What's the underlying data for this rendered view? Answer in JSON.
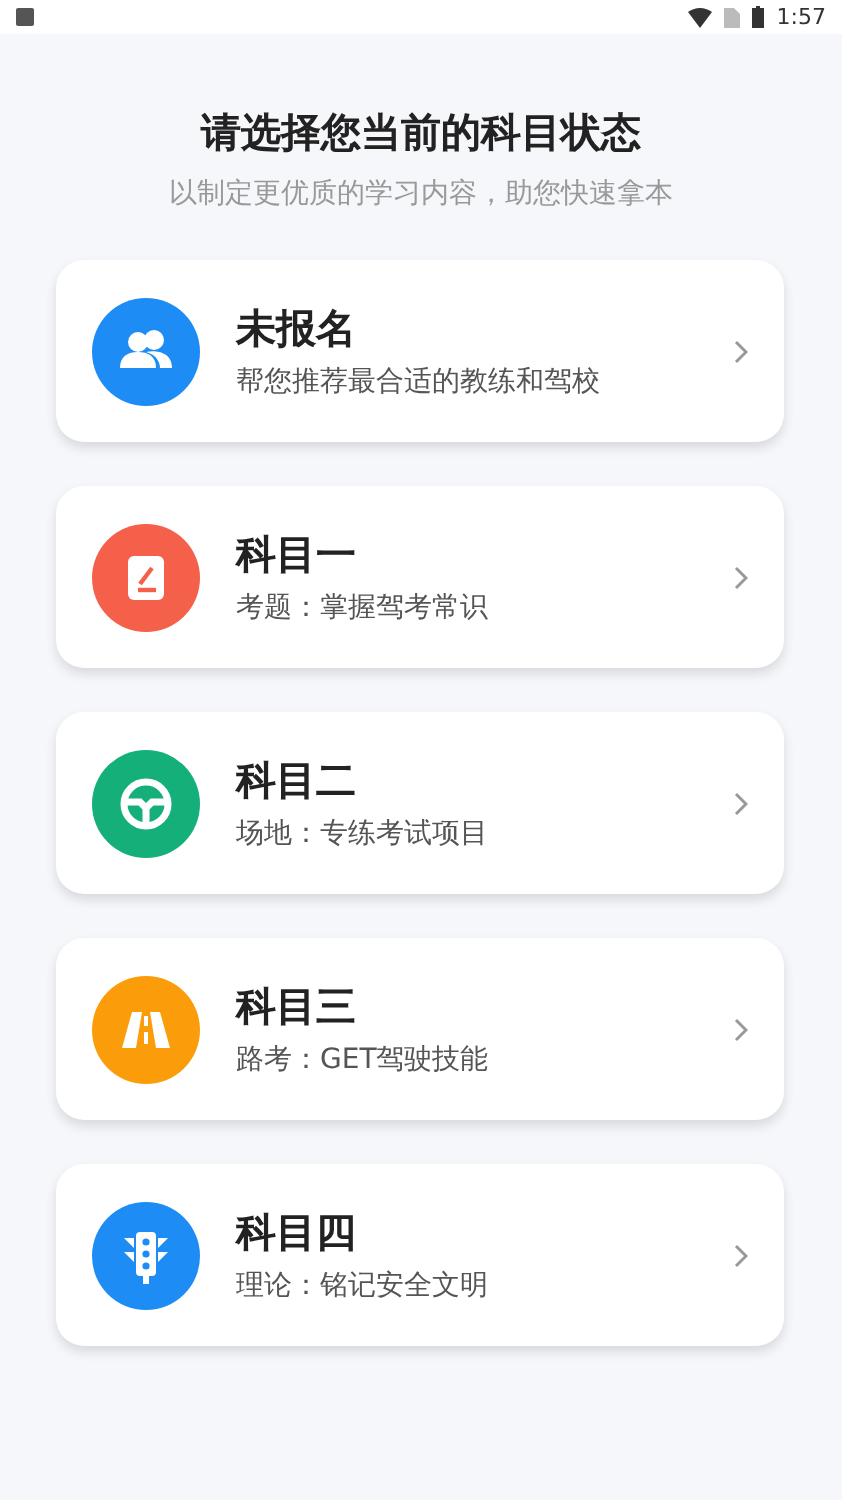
{
  "status_bar": {
    "time": "1:57"
  },
  "header": {
    "title": "请选择您当前的科目状态",
    "subtitle": "以制定更优质的学习内容，助您快速拿本"
  },
  "options": [
    {
      "kind": "people",
      "color": "#1e8cf5",
      "title": "未报名",
      "subtitle": "帮您推荐最合适的教练和驾校"
    },
    {
      "kind": "note",
      "color": "#f5604a",
      "title": "科目一",
      "subtitle": "考题：掌握驾考常识"
    },
    {
      "kind": "wheel",
      "color": "#15b07a",
      "title": "科目二",
      "subtitle": "场地：专练考试项目"
    },
    {
      "kind": "road",
      "color": "#fb9c0a",
      "title": "科目三",
      "subtitle": "路考：GET驾驶技能"
    },
    {
      "kind": "light",
      "color": "#1e8cf5",
      "title": "科目四",
      "subtitle": "理论：铭记安全文明"
    }
  ]
}
